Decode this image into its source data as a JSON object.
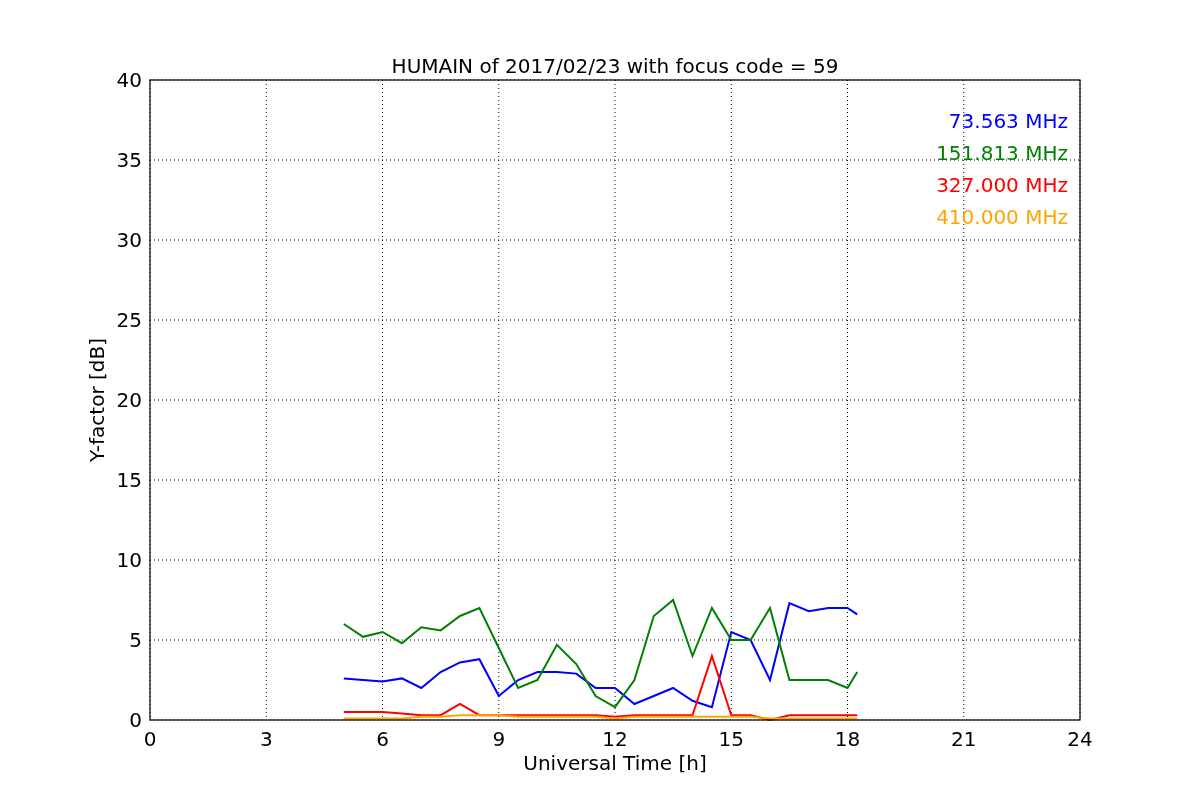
{
  "figure": {
    "chart_data": {
      "type": "line",
      "title": "HUMAIN of 2017/02/23 with focus code = 59",
      "xlabel": "Universal Time [h]",
      "ylabel": "Y-factor [dB]",
      "x": [
        5,
        5.5,
        6,
        6.5,
        7,
        7.5,
        8,
        8.5,
        9,
        9.5,
        10,
        10.5,
        11,
        11.5,
        12,
        12.5,
        13,
        13.5,
        14,
        14.5,
        15,
        15.5,
        16,
        16.5,
        17,
        17.5,
        18,
        18.25
      ],
      "series": [
        {
          "name": "73.563 MHz",
          "color": "#0000ff",
          "values": [
            2.6,
            2.5,
            2.4,
            2.6,
            2.0,
            3.0,
            3.6,
            3.8,
            1.5,
            2.5,
            3.0,
            3.0,
            2.9,
            2.0,
            2.0,
            1.0,
            1.5,
            2.0,
            1.2,
            0.8,
            5.5,
            5.0,
            2.5,
            7.3,
            6.8,
            7.0,
            7.0,
            6.6
          ]
        },
        {
          "name": "151.813 MHz",
          "color": "#008000",
          "values": [
            6.0,
            5.2,
            5.5,
            4.8,
            5.8,
            5.6,
            6.5,
            7.0,
            4.5,
            2.0,
            2.5,
            4.7,
            3.5,
            1.5,
            0.8,
            2.5,
            6.5,
            7.5,
            4.0,
            7.0,
            5.0,
            5.0,
            7.0,
            2.5,
            2.5,
            2.5,
            2.0,
            3.0
          ]
        },
        {
          "name": "327.000 MHz",
          "color": "#ff0000",
          "values": [
            0.5,
            0.5,
            0.5,
            0.4,
            0.3,
            0.3,
            1.0,
            0.3,
            0.3,
            0.3,
            0.3,
            0.3,
            0.3,
            0.3,
            0.2,
            0.3,
            0.3,
            0.3,
            0.3,
            4.0,
            0.3,
            0.3,
            0.0,
            0.3,
            0.3,
            0.3,
            0.3,
            0.3
          ]
        },
        {
          "name": "410.000 MHz",
          "color": "#ffa500",
          "values": [
            0.1,
            0.1,
            0.1,
            0.1,
            0.2,
            0.2,
            0.3,
            0.3,
            0.3,
            0.2,
            0.2,
            0.2,
            0.2,
            0.2,
            0.1,
            0.2,
            0.2,
            0.2,
            0.2,
            0.2,
            0.2,
            0.2,
            0.1,
            0.1,
            0.1,
            0.1,
            0.1,
            0.1
          ]
        }
      ],
      "grid": true,
      "xlim": [
        0,
        24
      ],
      "ylim": [
        0,
        40
      ],
      "xticks": [
        0,
        3,
        6,
        9,
        12,
        15,
        18,
        21,
        24
      ],
      "yticks": [
        0,
        5,
        10,
        15,
        20,
        25,
        30,
        35,
        40
      ]
    }
  }
}
